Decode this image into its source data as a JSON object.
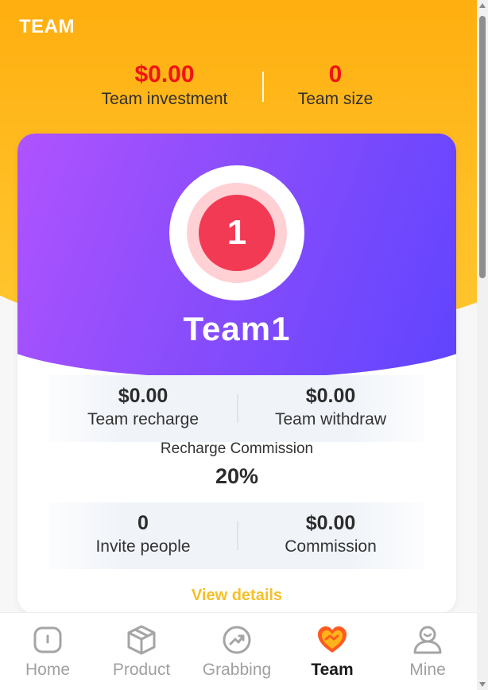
{
  "header": {
    "title": "TEAM"
  },
  "summary": {
    "investment_value": "$0.00",
    "investment_label": "Team investment",
    "size_value": "0",
    "size_label": "Team size"
  },
  "team_card": {
    "badge_number": "1",
    "team_name": "Team1",
    "recharge_value": "$0.00",
    "recharge_label": "Team recharge",
    "withdraw_value": "$0.00",
    "withdraw_label": "Team withdraw",
    "commission_rate_label": "Recharge Commission",
    "commission_rate_value": "20%",
    "invite_value": "0",
    "invite_label": "Invite people",
    "commission_value": "$0.00",
    "commission_label": "Commission",
    "view_details_label": "View details"
  },
  "nav": {
    "items": [
      {
        "label": "Home",
        "icon": "home-icon"
      },
      {
        "label": "Product",
        "icon": "box-icon"
      },
      {
        "label": "Grabbing",
        "icon": "trend-icon"
      },
      {
        "label": "Team",
        "icon": "handshake-heart-icon"
      },
      {
        "label": "Mine",
        "icon": "user-icon"
      }
    ],
    "active": "Team"
  },
  "colors": {
    "header_orange": "#ffae0f",
    "summary_red": "#f01414",
    "card_purple_start": "#b454ff",
    "card_purple_end": "#5b43ff",
    "badge_red": "#f23a54",
    "view_details_yellow": "#f5c02a"
  }
}
